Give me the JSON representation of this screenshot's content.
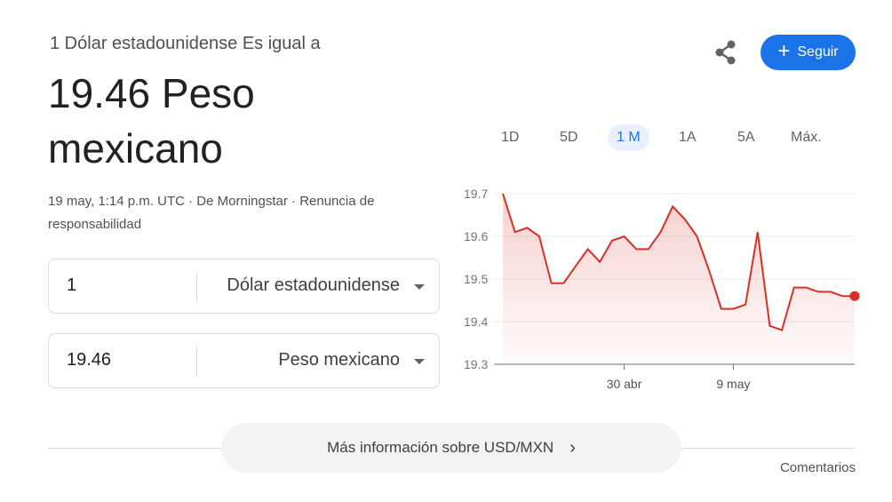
{
  "header": {
    "subtitle": "1 Dólar estadounidense Es igual a",
    "rate": "19.46 Peso mexicano",
    "timestamp": "19 may, 1:14 p.m. UTC",
    "source_sep": " · ",
    "source": "De Morningstar",
    "disclaimer_sep": " · ",
    "disclaimer": "Renuncia de responsabilidad"
  },
  "actions": {
    "share_icon": "share-icon",
    "follow_label": "Seguir",
    "follow_plus": "+"
  },
  "converter": {
    "from": {
      "amount": "1",
      "currency": "Dólar estadounidense"
    },
    "to": {
      "amount": "19.46",
      "currency": "Peso mexicano"
    }
  },
  "range_tabs": [
    "1D",
    "5D",
    "1 M",
    "1A",
    "5A",
    "Máx."
  ],
  "active_range": "1 M",
  "colors": {
    "accent": "#1a73e8",
    "line": "#d93025",
    "fill": "#fce8e6"
  },
  "chart_data": {
    "type": "area",
    "x": [
      "20 abr",
      "21 abr",
      "22 abr",
      "23 abr",
      "24 abr",
      "25 abr",
      "26 abr",
      "27 abr",
      "28 abr",
      "29 abr",
      "30 abr",
      "1 may",
      "2 may",
      "3 may",
      "4 may",
      "5 may",
      "6 may",
      "7 may",
      "8 may",
      "9 may",
      "10 may",
      "11 may",
      "12 may",
      "13 may",
      "14 may",
      "15 may",
      "16 may",
      "17 may",
      "18 may",
      "19 may"
    ],
    "values": [
      19.7,
      19.61,
      19.62,
      19.6,
      19.49,
      19.49,
      19.53,
      19.57,
      19.54,
      19.59,
      19.6,
      19.57,
      19.57,
      19.61,
      19.67,
      19.64,
      19.6,
      19.52,
      19.43,
      19.43,
      19.44,
      19.61,
      19.39,
      19.38,
      19.48,
      19.48,
      19.47,
      19.47,
      19.46,
      19.46
    ],
    "yticks": [
      "19.7",
      "19.6",
      "19.5",
      "19.4",
      "19.3"
    ],
    "ylim": [
      19.3,
      19.7
    ],
    "xticks": [
      {
        "label": "30 abr",
        "index": 10
      },
      {
        "label": "9 may",
        "index": 19
      }
    ],
    "grid": true
  },
  "footer": {
    "more_label": "Más información sobre USD/MXN",
    "more_chevron": "›",
    "feedback": "Comentarios"
  }
}
